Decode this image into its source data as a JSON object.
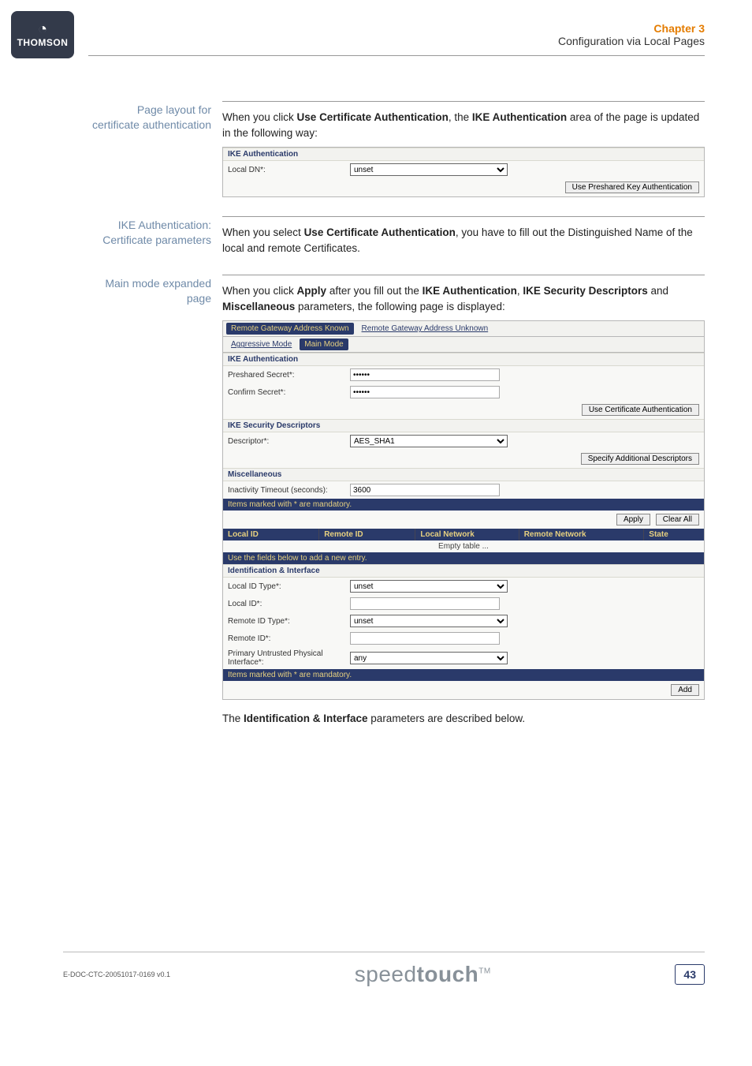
{
  "brand": "THOMSON",
  "header": {
    "chapter": "Chapter 3",
    "subtitle": "Configuration via Local Pages"
  },
  "sections": {
    "s1": {
      "label": "Page layout for certificate authentication",
      "intro_pre": "When you click ",
      "intro_b1": "Use Certificate Authentication",
      "intro_mid": ", the ",
      "intro_b2": "IKE Authentication",
      "intro_post": " area of the page is updated in the following way:",
      "panel": {
        "sec_title": "IKE Authentication",
        "row_label": "Local DN*:",
        "row_value": "unset",
        "btn": "Use Preshared Key Authentication"
      }
    },
    "s2": {
      "label": "IKE Authentication: Certificate parameters",
      "pre": "When you select ",
      "b1": "Use Certificate Authentication",
      "post": ", you have to fill out the Distinguished Name of the local and remote Certificates."
    },
    "s3": {
      "label": "Main mode expanded page",
      "pre": "When you click ",
      "b_apply": "Apply",
      "mid1": " after you fill out the ",
      "b_ike_auth": "IKE Authentication",
      "sep1": ", ",
      "b_ike_sec": "IKE Security Descriptors",
      "mid2": " and ",
      "b_misc": "Miscellaneous",
      "post": " parameters, the following page is displayed:",
      "panel": {
        "tabs1": {
          "a": "Remote Gateway Address Known",
          "b": "Remote Gateway Address Unknown"
        },
        "tabs2": {
          "a": "Aggressive Mode",
          "b": "Main Mode"
        },
        "sec_auth": "IKE Authentication",
        "preshared_label": "Preshared Secret*:",
        "confirm_label": "Confirm Secret*:",
        "btn_cert": "Use Certificate Authentication",
        "sec_desc": "IKE Security Descriptors",
        "desc_label": "Descriptor*:",
        "desc_value": "AES_SHA1",
        "btn_spec": "Specify Additional Descriptors",
        "sec_misc": "Miscellaneous",
        "timeout_label": "Inactivity Timeout (seconds):",
        "timeout_value": "3600",
        "mandatory_strip": "Items marked with * are mandatory.",
        "btn_apply": "Apply",
        "btn_clear": "Clear All",
        "tbl": {
          "c1": "Local ID",
          "c2": "Remote ID",
          "c3": "Local Network",
          "c4": "Remote Network",
          "c5": "State"
        },
        "empty": "Empty table ...",
        "strip_add": "Use the fields below to add a new entry.",
        "sec_ident": "Identification & Interface",
        "local_id_type_label": "Local ID Type*:",
        "local_id_type_value": "unset",
        "local_id_label": "Local ID*:",
        "remote_id_type_label": "Remote ID Type*:",
        "remote_id_type_value": "unset",
        "remote_id_label": "Remote ID*:",
        "interface_label": "Primary Untrusted Physical Interface*:",
        "interface_value": "any",
        "btn_add": "Add"
      },
      "outro_pre": "The ",
      "outro_b": "Identification & Interface",
      "outro_post": " parameters are described below."
    }
  },
  "footer": {
    "docid": "E-DOC-CTC-20051017-0169 v0.1",
    "product_a": "speed",
    "product_b": "touch",
    "tm": "TM",
    "page": "43"
  }
}
